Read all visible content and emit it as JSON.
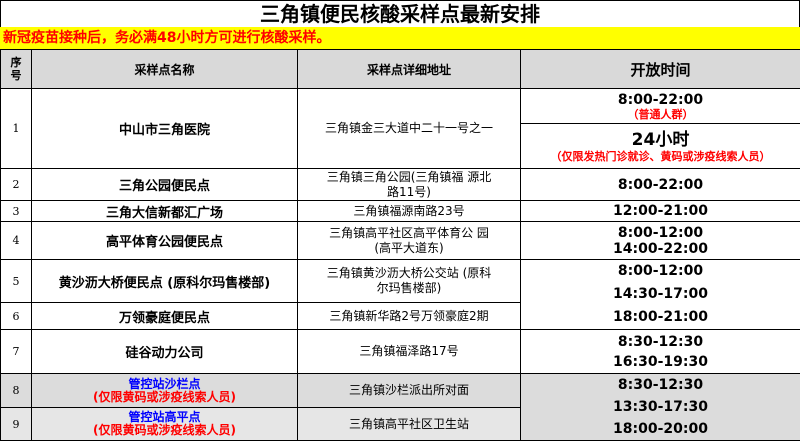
{
  "title": "三角镇便民核酸采样点最新安排",
  "notice": "新冠疫苗接种后，务必满48小时方可进行核酸采样。",
  "headers": {
    "seq_line1": "序",
    "seq_line2": "号",
    "name": "采样点名称",
    "address": "采样点详细地址",
    "hours": "开放时间"
  },
  "rows": [
    {
      "seq": "1",
      "name": "中山市三角医院",
      "address": "三角镇金三大道中二十一号之一",
      "time1": "8:00-22:00",
      "note1": "（普通人群）",
      "time2": "24小时",
      "note2": "（仅限发热门诊就诊、黄码或涉疫线索人员）"
    },
    {
      "seq": "2",
      "name": "三角公园便民点",
      "address_line1": "三角镇三角公园(三角镇福 源北",
      "address_line2": "路11号)",
      "time": "8:00-22:00"
    },
    {
      "seq": "3",
      "name": "三角大信新都汇广场",
      "address": "三角镇福源南路23号",
      "time": "12:00-21:00"
    },
    {
      "seq": "4",
      "name": "高平体育公园便民点",
      "address_line1": "三角镇高平社区高平体育公 园",
      "address_line2": "(高平大道东)",
      "time1": "8:00-12:00",
      "time2": "14:00-22:00"
    },
    {
      "seq": "5",
      "name": "黄沙沥大桥便民点 (原科尔玛售楼部)",
      "address_line1": "三角镇黄沙沥大桥公交站 (原科",
      "address_line2": "尔玛售楼部)",
      "time_a": "8:00-12:00",
      "time_b": "14:30-17:00"
    },
    {
      "seq": "6",
      "name": "万领豪庭便民点",
      "address": "三角镇新华路2号万领豪庭2期",
      "time_c": "18:00-21:00"
    },
    {
      "seq": "7",
      "name": "硅谷动力公司",
      "address": "三角镇福泽路17号",
      "time1": "8:30-12:30",
      "time2": "16:30-19:30"
    },
    {
      "seq": "8",
      "name": "管控站沙栏点",
      "name_note": "(仅限黄码或涉疫线索人员)",
      "address": "三角镇沙栏派出所对面",
      "time_a": "8:30-12:30",
      "time_b": "13:30-17:30"
    },
    {
      "seq": "9",
      "name": "管控站高平点",
      "name_note": "(仅限黄码或涉疫线索人员)",
      "address": "三角镇高平社区卫生站",
      "time_c": "18:00-20:00"
    }
  ],
  "colors": {
    "notice_bg": "#ffff00",
    "notice_text": "#ff0000",
    "header_bg": "#d9d9d9",
    "restricted_name": "#0000ff",
    "restricted_note": "#ff0000"
  }
}
